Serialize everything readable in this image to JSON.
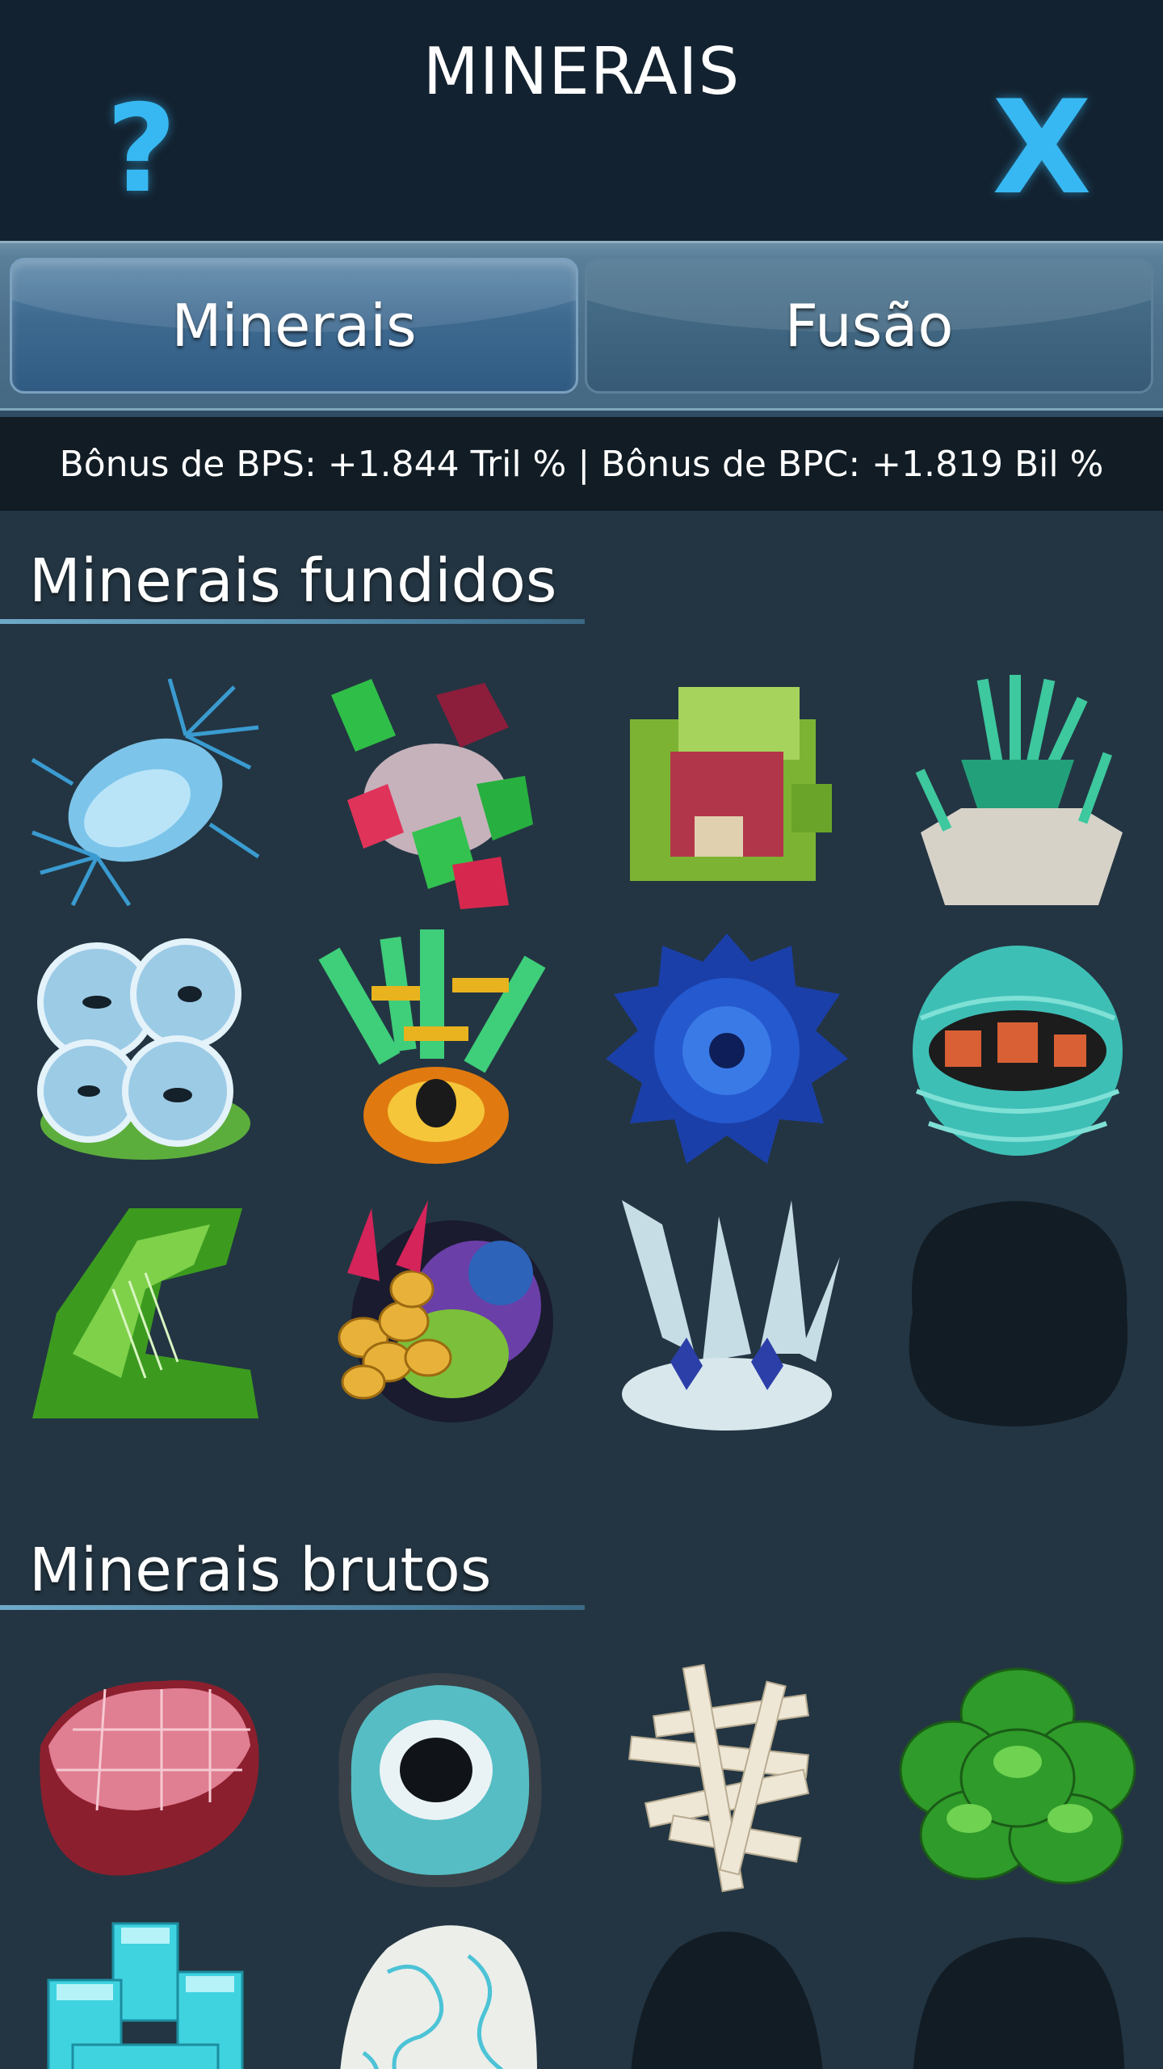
{
  "header": {
    "title": "MINERAIS",
    "help_icon": "question-mark-icon",
    "help_glyph": "?",
    "close_icon": "close-x-icon",
    "close_glyph": "X",
    "accent_color": "#37b8f2"
  },
  "tabs": [
    {
      "label": "Minerais",
      "active": true
    },
    {
      "label": "Fusão",
      "active": false
    }
  ],
  "bonus_text": "Bônus de BPS: +1.844 Tril % | Bônus de BPC: +1.819 Bil %",
  "sections": {
    "fused": {
      "title": "Minerais fundidos",
      "items": [
        {
          "icon": "blue-spiky-crystal-mineral-icon"
        },
        {
          "icon": "red-green-gem-cluster-mineral-icon"
        },
        {
          "icon": "green-red-cube-mineral-icon"
        },
        {
          "icon": "teal-crystal-fan-mineral-icon"
        },
        {
          "icon": "blue-geode-bubbles-mineral-icon"
        },
        {
          "icon": "green-crystal-flower-mineral-icon"
        },
        {
          "icon": "blue-scaled-orb-mineral-icon"
        },
        {
          "icon": "teal-sphere-orange-crystal-mineral-icon"
        },
        {
          "icon": "green-pixel-crystal-mineral-icon"
        },
        {
          "icon": "rainbow-rock-yellow-nodules-mineral-icon"
        },
        {
          "icon": "white-spire-blue-gem-mineral-icon"
        },
        {
          "icon": "locked-mineral-silhouette-icon"
        }
      ]
    },
    "raw": {
      "title": "Minerais brutos",
      "items": [
        {
          "icon": "pink-scaled-rock-mineral-icon"
        },
        {
          "icon": "teal-geode-mineral-icon"
        },
        {
          "icon": "white-stick-pile-mineral-icon"
        },
        {
          "icon": "green-leafy-mineral-icon"
        },
        {
          "icon": "cyan-cube-crystal-mineral-icon"
        },
        {
          "icon": "white-marbled-rock-mineral-icon"
        },
        {
          "icon": "locked-mineral-silhouette-icon"
        },
        {
          "icon": "locked-mineral-silhouette-icon"
        }
      ]
    }
  }
}
